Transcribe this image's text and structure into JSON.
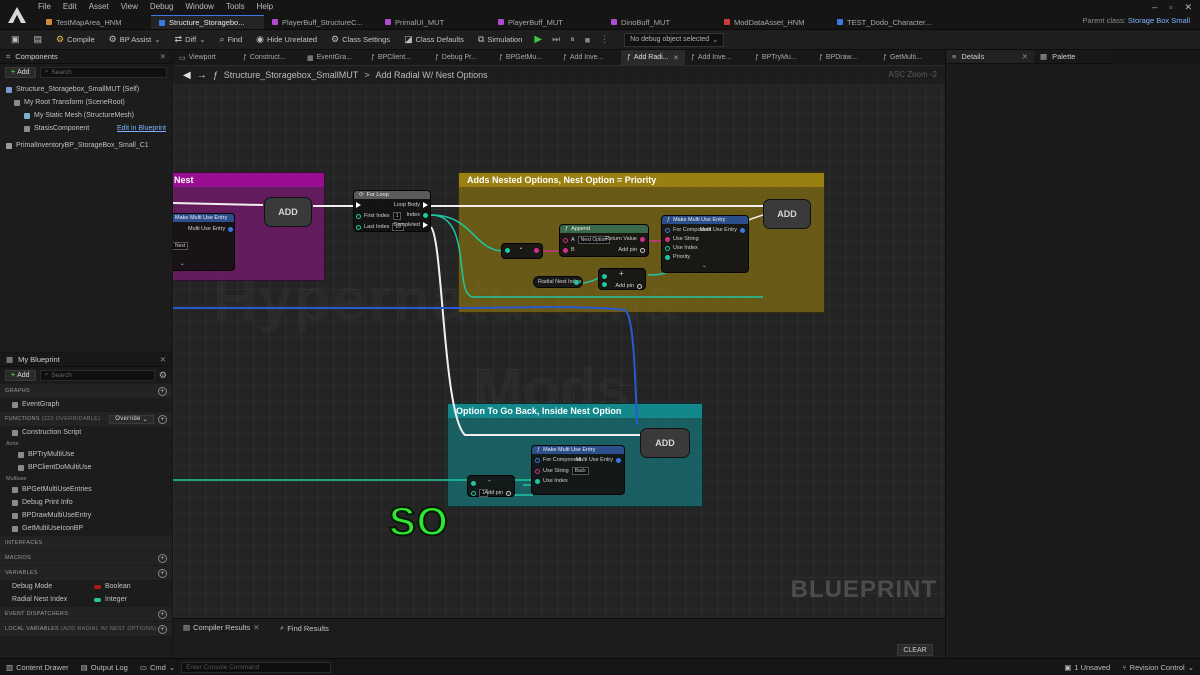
{
  "menu": [
    "File",
    "Edit",
    "Asset",
    "View",
    "Debug",
    "Window",
    "Tools",
    "Help"
  ],
  "tabs": [
    {
      "label": "TestMapArea_HNM",
      "color": "#d08a3a"
    },
    {
      "label": "Structure_Storagebo...",
      "color": "#3a7ae0",
      "active": true
    },
    {
      "label": "PlayerBuff_StructureC...",
      "color": "#b04ad0"
    },
    {
      "label": "PrimalUI_MUT",
      "color": "#b04ad0"
    },
    {
      "label": "PlayerBuff_MUT",
      "color": "#b04ad0"
    },
    {
      "label": "DinoBuff_MUT",
      "color": "#b04ad0"
    },
    {
      "label": "ModDataAsset_HNM",
      "color": "#d03a3a"
    },
    {
      "label": "TEST_Dodo_Character...",
      "color": "#3a7ae0"
    }
  ],
  "parent_class": {
    "label": "Parent class:",
    "value": "Storage Box Small"
  },
  "window_controls": [
    "–",
    "▫",
    "✕"
  ],
  "toolbar": {
    "compile": "Compile",
    "bp_assist": "BP Assist",
    "diff": "Diff",
    "find": "Find",
    "hide_unrelated": "Hide Unrelated",
    "class_settings": "Class Settings",
    "class_defaults": "Class Defaults",
    "simulation": "Simulation",
    "debug_object": "No debug object selected"
  },
  "components": {
    "title": "Components",
    "add": "Add",
    "search": "Search",
    "root": "Structure_Storagebox_SmallMUT (Self)",
    "items": [
      {
        "label": "My Root Transform (SceneRoot)",
        "indent": 1
      },
      {
        "label": "My Static Mesh (StructureMesh)",
        "indent": 2
      },
      {
        "label": "StasisComponent",
        "indent": 2,
        "link": "Edit in Blueprint"
      },
      {
        "label": "PrimalInventoryBP_StorageBox_Small_C1",
        "indent": 0
      }
    ]
  },
  "my_blueprint": {
    "title": "My Blueprint",
    "add": "Add",
    "search": "Search",
    "graphs_label": "GRAPHS",
    "graphs": [
      "EventGraph"
    ],
    "functions_label": "FUNCTIONS",
    "functions_count": "(222 OVERRIDABLE)",
    "override": "Override",
    "functions_top": [
      "Construction Script"
    ],
    "actor_label": "Actor",
    "actor_items": [
      "BPTryMultiUse",
      "BPClientDoMultiUse"
    ],
    "multiuse_label": "Multiuse",
    "multiuse_items": [
      "BPGetMultiUseEntries",
      "Debug Print Info",
      "BPDrawMultiUseEntry",
      "GetMultiUseIconBP"
    ],
    "interfaces_label": "INTERFACES",
    "macros_label": "MACROS",
    "variables_label": "VARIABLES",
    "variables": [
      {
        "name": "Debug Mode",
        "type": "Boolean",
        "color": "#b01818"
      },
      {
        "name": "Radial Nest Index",
        "type": "Integer",
        "color": "#1fc8a0"
      }
    ],
    "event_dispatchers_label": "EVENT DISPATCHERS",
    "local_variables_label": "LOCAL VARIABLES",
    "local_variables_scope": "(ADD RADIAL W/ NEST OPTIONS)"
  },
  "doc_tabs": [
    "Viewport",
    "Construct...",
    "EventGra...",
    "BPClient...",
    "Debug Pr...",
    "BPGetMu...",
    "Add Inve...",
    "Add Radi...",
    "Add Inve...",
    "BPTryMu...",
    "BPDraw...",
    "GetMulti..."
  ],
  "doc_tabs_active": 7,
  "details": {
    "title": "Details"
  },
  "palette": {
    "title": "Palette"
  },
  "breadcrumb": {
    "root": "Structure_Storagebox_SmallMUT",
    "sep": ">",
    "current": "Add Radial W/ Nest Options"
  },
  "zoom": "ASC Zoom -2",
  "graph": {
    "comment_left": "Nest",
    "comment_yellow": "Adds Nested Options, Nest Option = Priority",
    "comment_teal": "Option To Go Back, Inside Nest Option",
    "add_label": "ADD",
    "for_loop": {
      "title": "For Loop",
      "first": "First Index",
      "first_val": "1",
      "last": "Last Index",
      "last_val": "10",
      "body": "Loop Body",
      "index": "Index",
      "completed": "Completed"
    },
    "make_entry": {
      "title": "Make Multi Use Entry",
      "for_component": "For Component",
      "multi_use_entry": "Multi Use Entry",
      "use_string": "Use String",
      "use_index": "Use Index",
      "priority": "Priority"
    },
    "append": {
      "title": "Append",
      "a": "A",
      "a_val": "Nest Option",
      "b": "B",
      "return": "Return Value",
      "add_pin": "Add pin"
    },
    "radial_var": "Radial Nest Index",
    "teal_entry_string": "Back",
    "teal_field": "1",
    "add_pin": "Add pin",
    "plus": "+",
    "minus": "-",
    "left_node_title": "Make Multi Use Entry",
    "left_node_out": "Multi Use Entry",
    "left_node_field": "Nest"
  },
  "watermark_text": "Hypernaturema",
  "watermark_text2": "Mods",
  "bp_watermark": "BLUEPRINT",
  "caption": "SO",
  "bottom": {
    "compiler_results": "Compiler Results",
    "find_results": "Find Results",
    "clear": "CLEAR"
  },
  "status": {
    "content_drawer": "Content Drawer",
    "output_log": "Output Log",
    "cmd": "Cmd",
    "console_placeholder": "Enter Console Command",
    "unsaved": "1 Unsaved",
    "revision": "Revision Control"
  }
}
